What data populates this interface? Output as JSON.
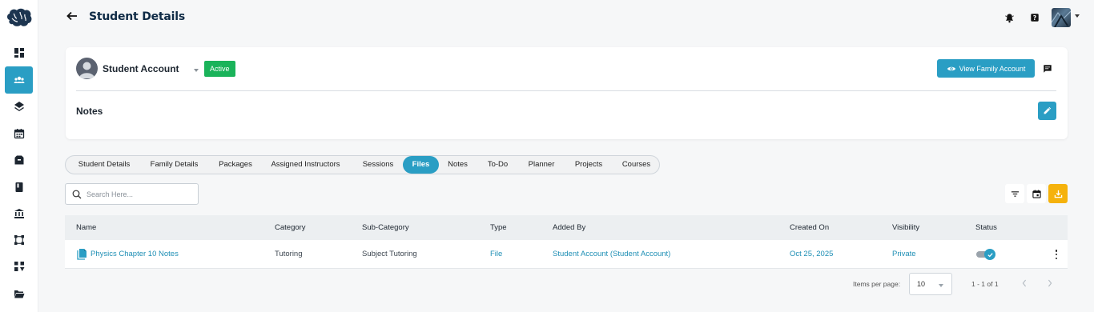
{
  "header": {
    "title": "Student Details"
  },
  "sidebar": {
    "items": [
      {
        "name": "dashboard",
        "icon": "dashboard-icon"
      },
      {
        "name": "users",
        "icon": "users-icon",
        "active": true
      },
      {
        "name": "layers",
        "icon": "layers-icon"
      },
      {
        "name": "calendar",
        "icon": "calendar-icon"
      },
      {
        "name": "inventory",
        "icon": "box-icon"
      },
      {
        "name": "book",
        "icon": "book-icon"
      },
      {
        "name": "institution",
        "icon": "bank-icon"
      },
      {
        "name": "workflow",
        "icon": "workflow-icon"
      },
      {
        "name": "reports",
        "icon": "chart-down-icon"
      },
      {
        "name": "folders",
        "icon": "folder-icon"
      }
    ]
  },
  "account": {
    "name": "Student Account",
    "status": "Active",
    "view_family_label": "View Family Account",
    "notes_title": "Notes"
  },
  "tabs": [
    {
      "label": "Student Details"
    },
    {
      "label": "Family Details"
    },
    {
      "label": "Packages"
    },
    {
      "label": "Assigned Instructors"
    },
    {
      "label": "Sessions"
    },
    {
      "label": "Files",
      "active": true
    },
    {
      "label": "Notes"
    },
    {
      "label": "To-Do"
    },
    {
      "label": "Planner"
    },
    {
      "label": "Projects"
    },
    {
      "label": "Courses"
    }
  ],
  "search": {
    "placeholder": "Search Here..."
  },
  "table": {
    "columns": [
      "Name",
      "Category",
      "Sub-Category",
      "Type",
      "Added By",
      "Created On",
      "Visibility",
      "Status"
    ],
    "rows": [
      {
        "name": "Physics Chapter 10 Notes",
        "category": "Tutoring",
        "sub_category": "Subject Tutoring",
        "type": "File",
        "added_by": "Student Account (Student Account)",
        "created_on": "Oct 25, 2025",
        "visibility": "Private",
        "status_on": true
      }
    ]
  },
  "paginator": {
    "items_per_page_label": "Items per page:",
    "page_size": "10",
    "range_label": "1 - 1 of 1"
  },
  "colors": {
    "accent": "#2a9ec4",
    "active_badge": "#1ab35a",
    "download_button": "#f5b20c",
    "title": "#0f2b46"
  }
}
